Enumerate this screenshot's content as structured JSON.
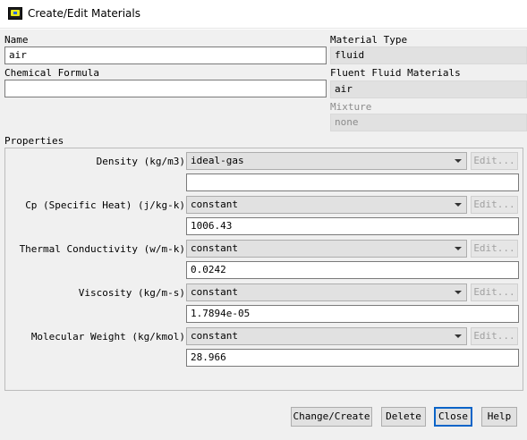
{
  "window": {
    "title": "Create/Edit Materials"
  },
  "name": {
    "label": "Name",
    "value": "air"
  },
  "chemical_formula": {
    "label": "Chemical Formula",
    "value": ""
  },
  "material_type": {
    "label": "Material Type",
    "value": "fluid"
  },
  "fluent_fluid_materials": {
    "label": "Fluent Fluid Materials",
    "value": "air"
  },
  "mixture": {
    "label": "Mixture",
    "value": "none"
  },
  "properties": {
    "label": "Properties",
    "edit_label": "Edit...",
    "items": [
      {
        "label": "Density (kg/m3)",
        "method": "ideal-gas",
        "value": ""
      },
      {
        "label": "Cp (Specific Heat) (j/kg-k)",
        "method": "constant",
        "value": "1006.43"
      },
      {
        "label": "Thermal Conductivity (w/m-k)",
        "method": "constant",
        "value": "0.0242"
      },
      {
        "label": "Viscosity (kg/m-s)",
        "method": "constant",
        "value": "1.7894e-05"
      },
      {
        "label": "Molecular Weight (kg/kmol)",
        "method": "constant",
        "value": "28.966"
      }
    ]
  },
  "buttons": {
    "change_create": "Change/Create",
    "delete": "Delete",
    "close": "Close",
    "help": "Help"
  },
  "colors": {
    "default_button_border": "#0a64c8",
    "panel_background": "#f0f0f0"
  }
}
